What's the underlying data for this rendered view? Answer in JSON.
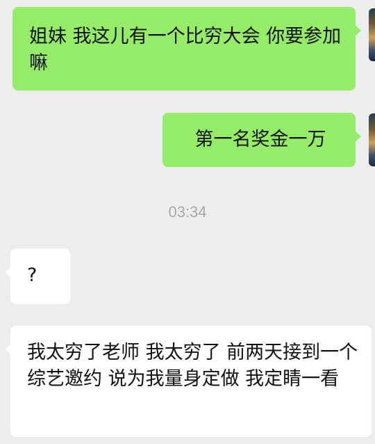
{
  "conversation": {
    "messages": [
      {
        "direction": "sent",
        "text": "姐妹 我这儿有一个比穷大会 你要参加嘛"
      },
      {
        "direction": "sent",
        "text": "第一名奖金一万"
      },
      {
        "direction": "received",
        "text": "?"
      },
      {
        "direction": "received",
        "text": "我太穷了老师 我太穷了 前两天接到一个综艺邀约 说为我量身定做 我定睛一看"
      }
    ],
    "timestamp": "03:34"
  },
  "colors": {
    "background": "#ededed",
    "sent_bubble": "#95ec69",
    "received_bubble": "#ffffff",
    "timestamp_text": "#a8a8a8"
  }
}
